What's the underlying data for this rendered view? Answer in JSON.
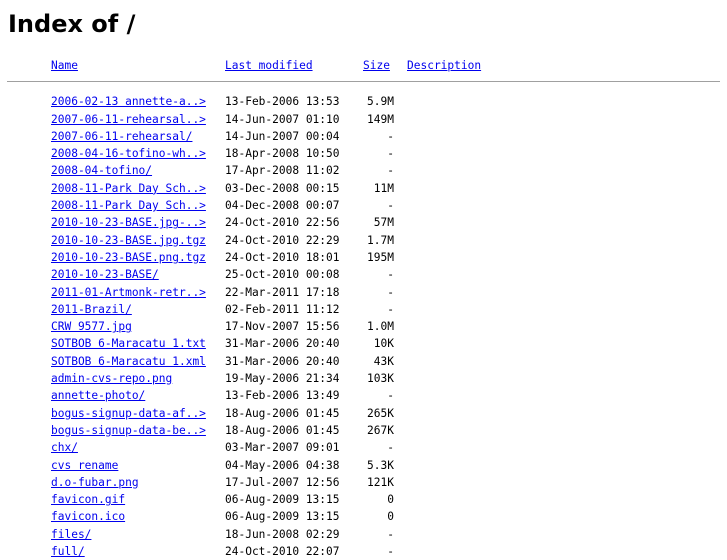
{
  "title": "Index of /",
  "headers": {
    "name": "Name",
    "last_modified": "Last modified",
    "size": "Size",
    "description": "Description"
  },
  "entries": [
    {
      "name": "2006-02-13 annette-a..>",
      "date": "13-Feb-2006 13:53",
      "size": "5.9M"
    },
    {
      "name": "2007-06-11-rehearsal..>",
      "date": "14-Jun-2007 01:10",
      "size": "149M"
    },
    {
      "name": "2007-06-11-rehearsal/",
      "date": "14-Jun-2007 00:04",
      "size": "-"
    },
    {
      "name": "2008-04-16-tofino-wh..>",
      "date": "18-Apr-2008 10:50",
      "size": "-"
    },
    {
      "name": "2008-04-tofino/",
      "date": "17-Apr-2008 11:02",
      "size": "-"
    },
    {
      "name": "2008-11-Park Day Sch..>",
      "date": "03-Dec-2008 00:15",
      "size": "11M"
    },
    {
      "name": "2008-11-Park Day Sch..>",
      "date": "04-Dec-2008 00:07",
      "size": "-"
    },
    {
      "name": "2010-10-23-BASE.jpg-..>",
      "date": "24-Oct-2010 22:56",
      "size": "57M"
    },
    {
      "name": "2010-10-23-BASE.jpg.tgz",
      "date": "24-Oct-2010 22:29",
      "size": "1.7M"
    },
    {
      "name": "2010-10-23-BASE.png.tgz",
      "date": "24-Oct-2010 18:01",
      "size": "195M"
    },
    {
      "name": "2010-10-23-BASE/",
      "date": "25-Oct-2010 00:08",
      "size": "-"
    },
    {
      "name": "2011-01-Artmonk-retr..>",
      "date": "22-Mar-2011 17:18",
      "size": "-"
    },
    {
      "name": "2011-Brazil/",
      "date": "02-Feb-2011 11:12",
      "size": "-"
    },
    {
      "name": "CRW 9577.jpg",
      "date": "17-Nov-2007 15:56",
      "size": "1.0M"
    },
    {
      "name": "SOTBOB 6-Maracatu 1.txt",
      "date": "31-Mar-2006 20:40",
      "size": "10K"
    },
    {
      "name": "SOTBOB 6-Maracatu 1.xml",
      "date": "31-Mar-2006 20:40",
      "size": "43K"
    },
    {
      "name": "admin-cvs-repo.png",
      "date": "19-May-2006 21:34",
      "size": "103K"
    },
    {
      "name": "annette-photo/",
      "date": "13-Feb-2006 13:49",
      "size": "-"
    },
    {
      "name": "bogus-signup-data-af..>",
      "date": "18-Aug-2006 01:45",
      "size": "265K"
    },
    {
      "name": "bogus-signup-data-be..>",
      "date": "18-Aug-2006 01:45",
      "size": "267K"
    },
    {
      "name": "chx/",
      "date": "03-Mar-2007 09:01",
      "size": "-"
    },
    {
      "name": "cvs rename",
      "date": "04-May-2006 04:38",
      "size": "5.3K"
    },
    {
      "name": "d.o-fubar.png",
      "date": "17-Jul-2007 12:56",
      "size": "121K"
    },
    {
      "name": "favicon.gif",
      "date": "06-Aug-2009 13:15",
      "size": "0"
    },
    {
      "name": "favicon.ico",
      "date": "06-Aug-2009 13:15",
      "size": "0"
    },
    {
      "name": "files/",
      "date": "18-Jun-2008 02:29",
      "size": "-"
    },
    {
      "name": "full/",
      "date": "24-Oct-2010 22:07",
      "size": "-"
    }
  ]
}
